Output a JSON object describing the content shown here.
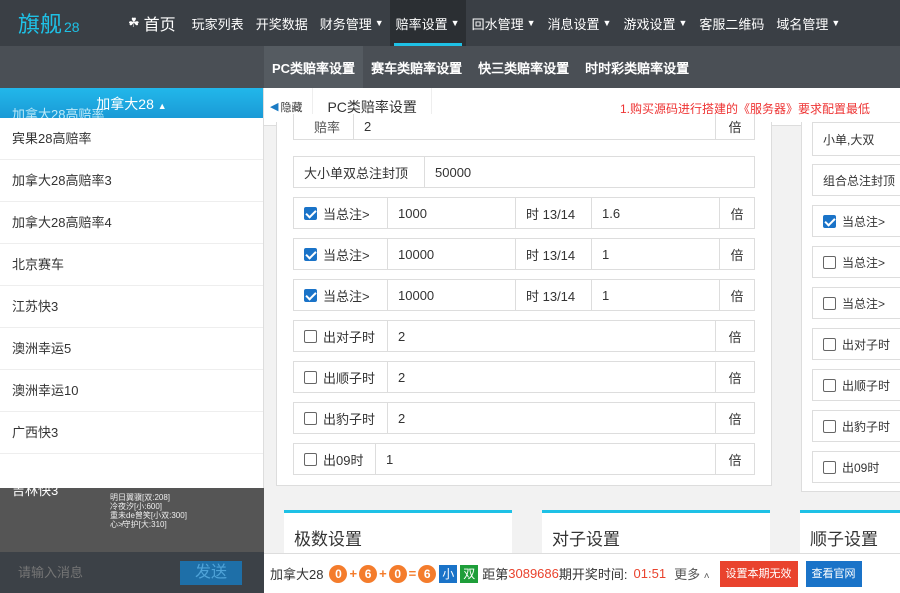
{
  "header": {
    "logo": "旗舰",
    "logo_num": "28",
    "nav": [
      {
        "label": "首页",
        "icon": "home-icon"
      },
      {
        "label": "玩家列表"
      },
      {
        "label": "开奖数据"
      },
      {
        "label": "财务管理",
        "dropdown": true
      },
      {
        "label": "赔率设置",
        "dropdown": true,
        "active": true
      },
      {
        "label": "回水管理",
        "dropdown": true
      },
      {
        "label": "消息设置",
        "dropdown": true
      },
      {
        "label": "游戏设置",
        "dropdown": true
      },
      {
        "label": "客服二维码"
      },
      {
        "label": "域名管理",
        "dropdown": true
      }
    ]
  },
  "subnav": [
    "PC类赔率设置",
    "赛车类赔率设置",
    "快三类赔率设置",
    "时时彩类赔率设置"
  ],
  "sidebar": {
    "title": "加拿大28",
    "ghost_item": "加拿大28高赔率",
    "items": [
      "宾果28高赔率",
      "加拿大28高赔率3",
      "加拿大28高赔率4",
      "北京赛车",
      "江苏快3",
      "澳洲幸运5",
      "澳洲幸运10",
      "广西快3"
    ],
    "partial_item": "吉林快3"
  },
  "chat": {
    "lines": [
      "明日翼骥[双:208]",
      "冷夜汐[小:600]",
      "重未de曾笑[小双:300]",
      "心≯守护[大:310]"
    ],
    "placeholder": "请输入消息",
    "send": "发送"
  },
  "crumb": {
    "hide_label": "隐藏",
    "tab": "PC类赔率设置",
    "notice": "1.购买源码进行搭建的《服务器》要求配置最低"
  },
  "form": {
    "odds_label": "赔率",
    "odds_value": "2",
    "unit": "倍",
    "cap_label": "大小单双总注封顶",
    "cap_value": "50000",
    "total_rows": [
      {
        "label": "当总注>",
        "amount": "1000",
        "time": "时 13/14",
        "odds": "1.6"
      },
      {
        "label": "当总注>",
        "amount": "10000",
        "time": "时 13/14",
        "odds": "1"
      },
      {
        "label": "当总注>",
        "amount": "10000",
        "time": "时 13/14",
        "odds": "1"
      }
    ],
    "special_rows": [
      {
        "label": "出对子时",
        "value": "2"
      },
      {
        "label": "出顺子时",
        "value": "2"
      },
      {
        "label": "出豹子时",
        "value": "2"
      },
      {
        "label": "出09时",
        "value": "1"
      }
    ]
  },
  "right_form": {
    "rows": [
      "小单,大双",
      "组合总注封顶",
      "当总注>",
      "当总注>",
      "当总注>",
      "出对子时",
      "出顺子时",
      "出豹子时",
      "出09时"
    ]
  },
  "cards": [
    "极数设置",
    "对子设置",
    "顺子设置"
  ],
  "status": {
    "game": "加拿大28",
    "balls": [
      "0",
      "6",
      "0",
      "6"
    ],
    "ops": [
      "+",
      "+",
      "="
    ],
    "size": "小",
    "parity": "双",
    "period_prefix": "距第",
    "period": "3089686",
    "period_suffix": "期开奖时间:",
    "countdown": "01:51",
    "more": "更多",
    "btn_invalid": "设置本期无效",
    "btn_official": "查看官网"
  },
  "colors": {
    "accent": "#1ec1e6",
    "orange": "#f47c2c",
    "red": "#e9432e",
    "blue": "#1a73c8",
    "green": "#1e9e3a"
  }
}
